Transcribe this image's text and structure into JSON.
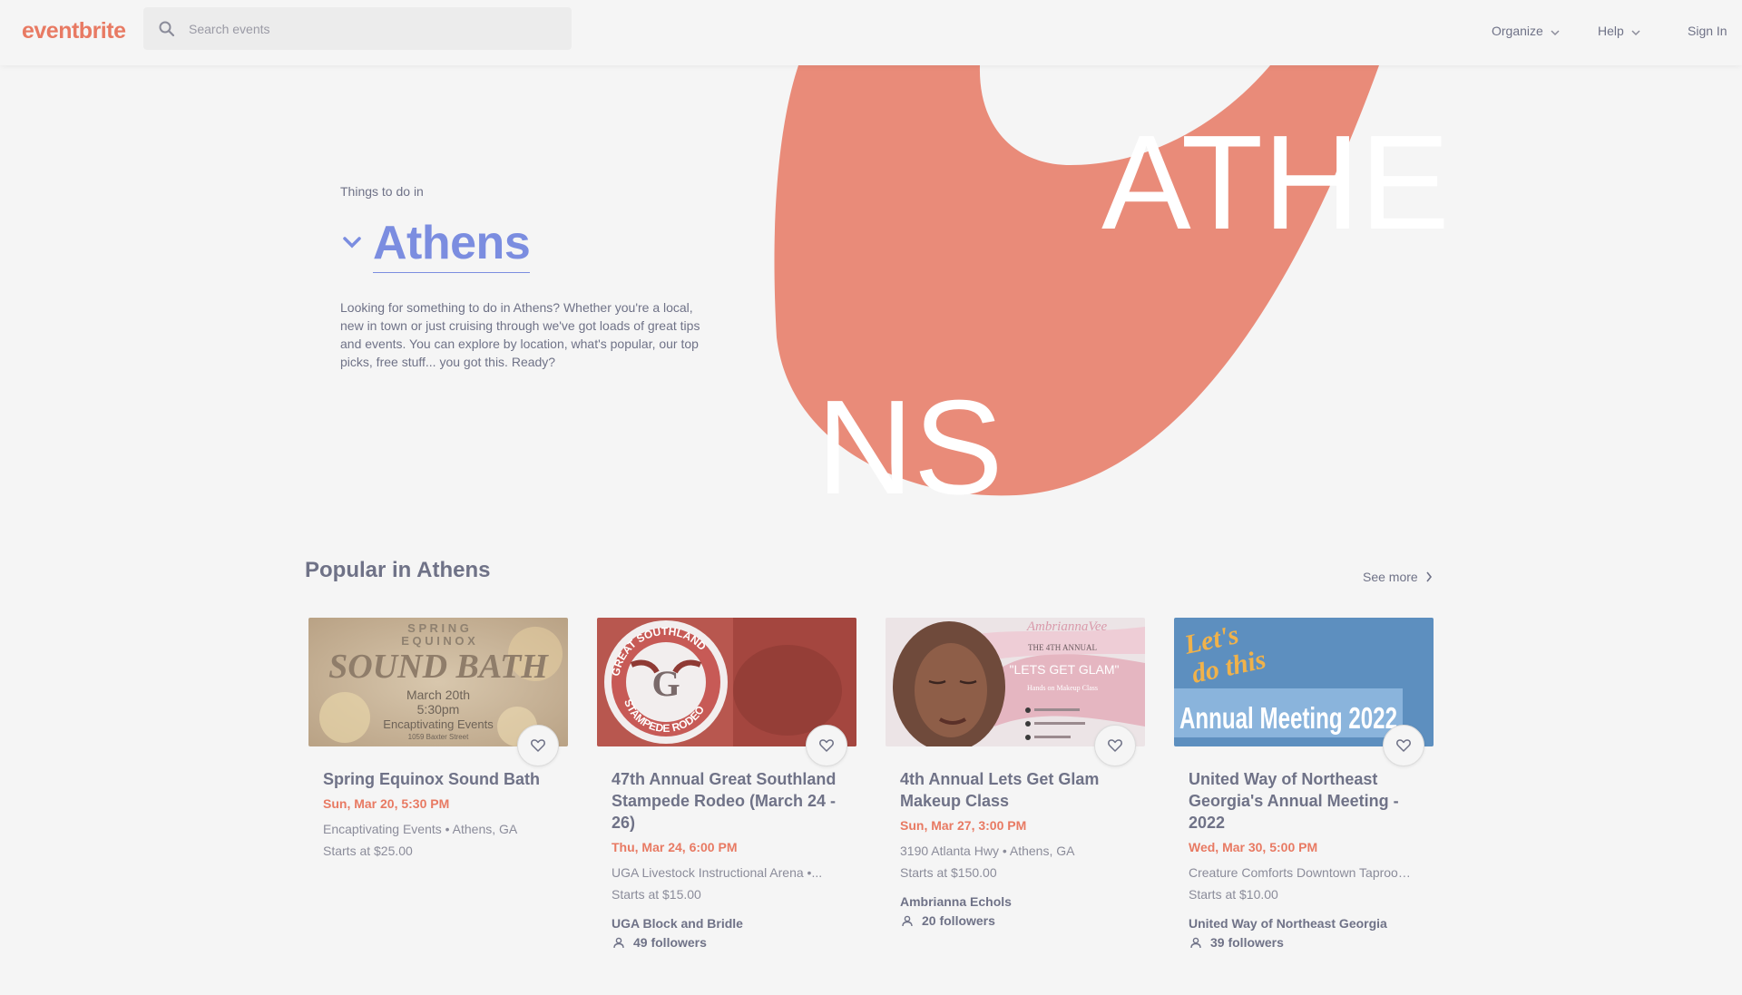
{
  "header": {
    "logo": "eventbrite",
    "search": {
      "placeholder": "Search events",
      "value": ""
    },
    "nav": [
      {
        "label": "Organize",
        "has_dropdown": true
      },
      {
        "label": "Help",
        "has_dropdown": true
      },
      {
        "label": "Sign In",
        "has_dropdown": false
      }
    ]
  },
  "hero": {
    "kicker": "Things to do in",
    "city": "Athens",
    "description": "Looking for something to do in Athens? Whether you're a local, new in town or just cruising through we've got loads of great tips and events. You can explore by location, what's popular, our top picks, free stuff... you got this. Ready?",
    "art_text_top": "ATHE",
    "art_text_bottom": "NS",
    "art_color": "#e98b79"
  },
  "popular": {
    "title": "Popular in Athens",
    "see_more": "See more",
    "events": [
      {
        "title": "Spring Equinox Sound Bath",
        "date": "Sun, Mar 20, 5:30 PM",
        "location": "Encaptivating Events • Athens, GA",
        "price": "Starts at $25.00",
        "organizer": "",
        "followers": "",
        "image_text": [
          "S P R I N G",
          "E Q U I N O X",
          "SOUND BATH",
          "March 20th",
          "5:30pm",
          "Encaptivating Events",
          "1059 Baxter Street"
        ]
      },
      {
        "title": "47th Annual Great Southland Stampede Rodeo (March 24 - 26)",
        "date": "Thu, Mar 24, 6:00 PM",
        "location": "UGA Livestock Instructional Arena •...",
        "price": "Starts at $15.00",
        "organizer": "UGA Block and Bridle",
        "followers": "49 followers",
        "image_text": [
          "GREAT SOUTHLAND",
          "STAMPEDE RODEO",
          "G"
        ]
      },
      {
        "title": "4th Annual Lets Get Glam Makeup Class",
        "date": "Sun, Mar 27, 3:00 PM",
        "location": "3190 Atlanta Hwy • Athens, GA",
        "price": "Starts at $150.00",
        "organizer": "Ambrianna Echols",
        "followers": "20 followers",
        "image_text": [
          "AmbriannaVee",
          "THE 4TH ANNUAL",
          "\"LETS GET GLAM\"",
          "Hands on Makeup Class"
        ]
      },
      {
        "title": "United Way of Northeast Georgia's Annual Meeting - 2022",
        "date": "Wed, Mar 30, 5:00 PM",
        "location": "Creature Comforts Downtown Taproom...",
        "price": "Starts at $10.00",
        "organizer": "United Way of Northeast Georgia",
        "followers": "39 followers",
        "image_text": [
          "Let's",
          "do this",
          "Annual Meeting 2022"
        ]
      }
    ]
  },
  "colors": {
    "brand": "#e87a63",
    "city_link": "#7b8de0",
    "date": "#e87a63"
  },
  "icons": [
    "search-icon",
    "chevron-down-icon",
    "chevron-right-icon",
    "heart-icon",
    "person-icon"
  ]
}
